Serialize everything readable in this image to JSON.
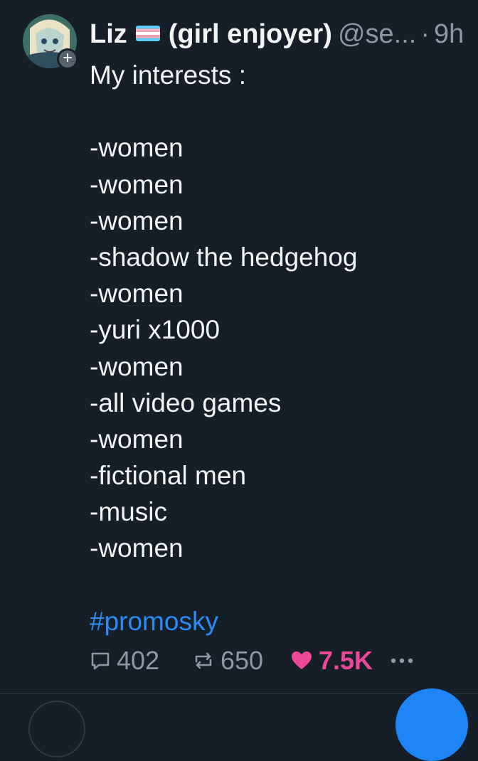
{
  "author": {
    "display_name": "Liz",
    "flag_icon": "transgender-flag-icon",
    "name_suffix": "(girl enjoyer)",
    "handle": "@se...",
    "separator": "·",
    "time": "9h"
  },
  "post": {
    "lines": [
      "My interests :",
      "",
      "-women",
      "-women",
      "-women",
      "-shadow the hedgehog",
      "-women",
      "-yuri x1000",
      "-women",
      "-all video games",
      "-women",
      "-fictional men",
      "-music",
      "-women",
      ""
    ],
    "hashtag": "#promosky"
  },
  "actions": {
    "replies": "402",
    "reposts": "650",
    "likes": "7.5K",
    "more_icon": "ellipsis-icon"
  },
  "colors": {
    "background": "#161e27",
    "text": "#f1f3f5",
    "muted": "#8b98a5",
    "link": "#2a8cf4",
    "like": "#ec4899",
    "fab": "#1d85f5"
  }
}
